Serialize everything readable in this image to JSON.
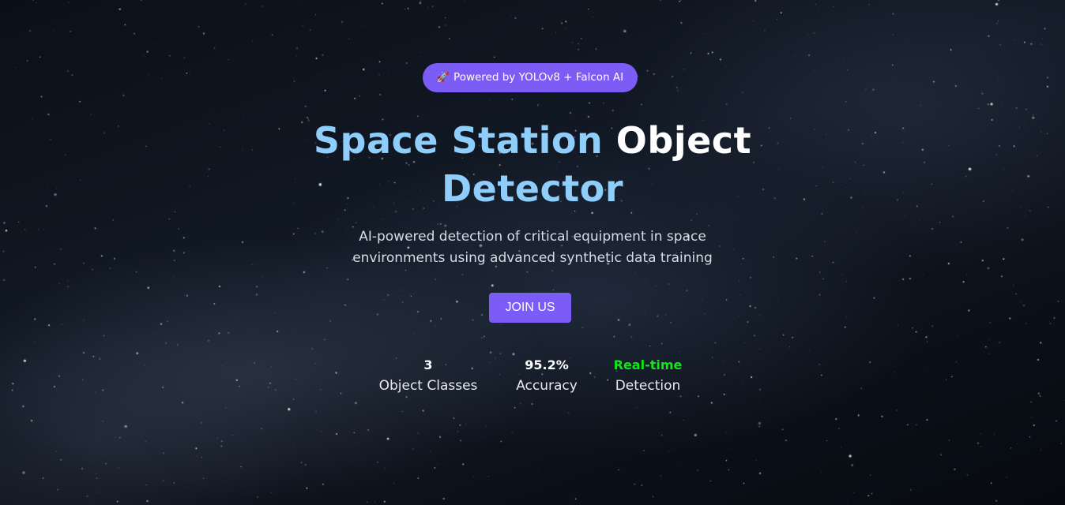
{
  "badge": {
    "icon": "rocket-icon",
    "label": "Powered by YOLOv8 + Falcon AI"
  },
  "hero": {
    "title_part1": "Space Station",
    "title_part2": "Object",
    "title_part3": "Detector",
    "subtitle_line1": "AI-powered detection of critical equipment in space",
    "subtitle_line2": "environments using advanced synthetic data training",
    "cta_label": "JOIN US"
  },
  "stats": [
    {
      "value": "3",
      "label": "Object Classes"
    },
    {
      "value": "95.2%",
      "label": "Accuracy"
    },
    {
      "value": "Real-time",
      "label": "Detection"
    }
  ],
  "colors": {
    "accent": "#7b5cf5",
    "title_accent": "#8fcdfb",
    "highlight_green": "#12e51a",
    "background": "#0b1018"
  }
}
